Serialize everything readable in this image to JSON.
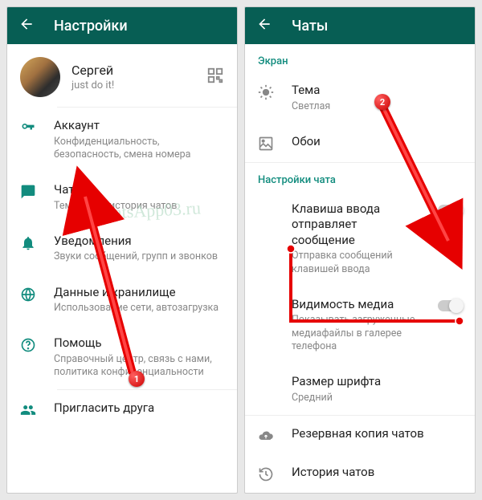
{
  "left": {
    "header": {
      "title": "Настройки"
    },
    "profile": {
      "name": "Сергей",
      "status": "just do it!"
    },
    "items": [
      {
        "title": "Аккаунт",
        "sub": "Конфиденциальность, безопасность, смена номера"
      },
      {
        "title": "Чаты",
        "sub": "Тема, обои, история чатов"
      },
      {
        "title": "Уведомления",
        "sub": "Звуки сообщений, групп и звонков"
      },
      {
        "title": "Данные и хранилище",
        "sub": "Использование сети, автозагрузка"
      },
      {
        "title": "Помощь",
        "sub": "Справочный центр, связь с нами, политика конфиденциальности"
      },
      {
        "title": "Пригласить друга"
      }
    ]
  },
  "right": {
    "header": {
      "title": "Чаты"
    },
    "section_screen": "Экран",
    "section_chat": "Настройки чата",
    "items": [
      {
        "title": "Тема",
        "sub": "Светлая"
      },
      {
        "title": "Обои"
      },
      {
        "title": "Клавиша ввода отправляет сообщение",
        "sub": "Отправка сообщений клавишей ввода"
      },
      {
        "title": "Видимость медиа",
        "sub": "Показывать загруженные медиафайлы в галерее телефона"
      },
      {
        "title": "Размер шрифта",
        "sub": "Средний"
      },
      {
        "title": "Резервная копия чатов"
      },
      {
        "title": "История чатов"
      }
    ]
  },
  "watermark": "WhatsApp03.ru",
  "annotations": {
    "badge1": "1",
    "badge2": "2"
  }
}
